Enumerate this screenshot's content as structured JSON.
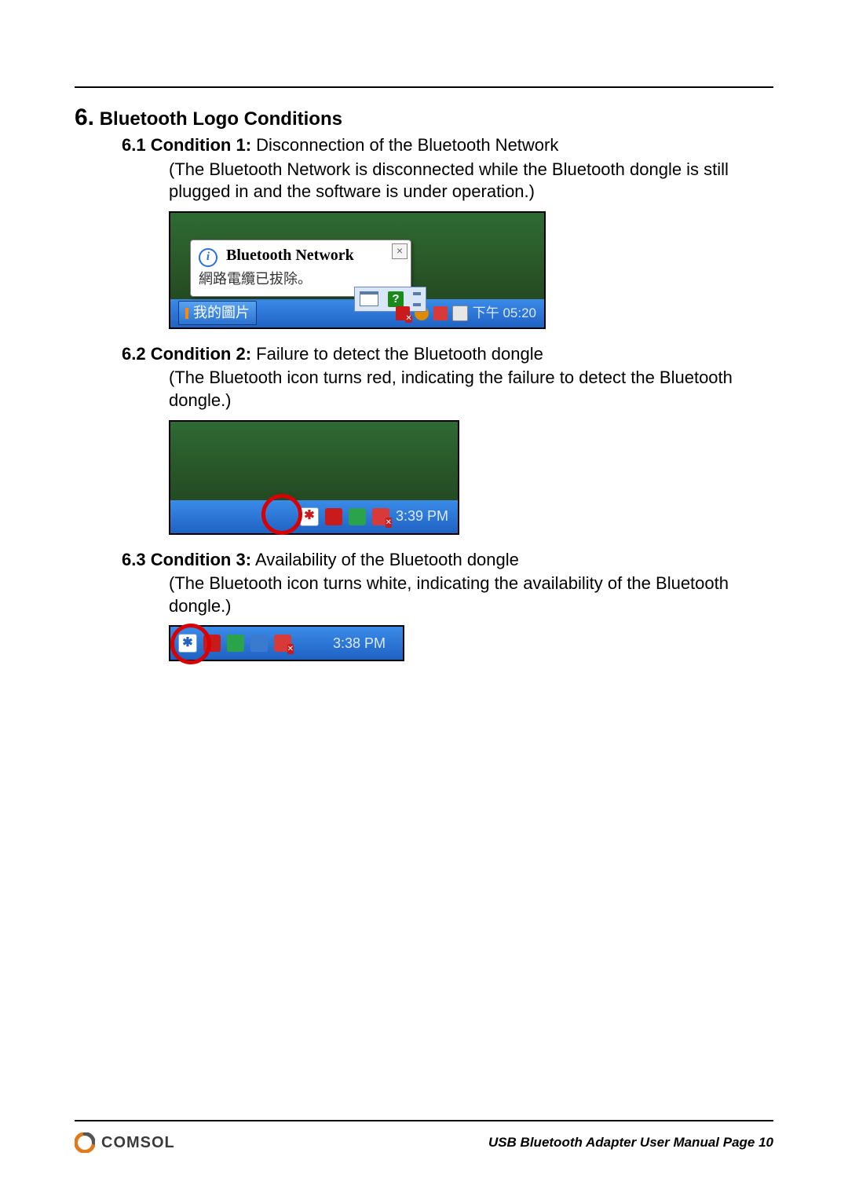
{
  "section": {
    "number": "6.",
    "title": "Bluetooth Logo Conditions"
  },
  "conditions": [
    {
      "num": "6.1",
      "label": "Condition 1:",
      "title": "Disconnection of the Bluetooth Network",
      "body": "(The Bluetooth Network is disconnected while the Bluetooth dongle is still plugged in and the software is under operation.)"
    },
    {
      "num": "6.2",
      "label": "Condition 2:",
      "title": "Failure to detect the Bluetooth dongle",
      "body": "(The Bluetooth icon turns red, indicating the failure to detect the Bluetooth dongle.)"
    },
    {
      "num": "6.3",
      "label": "Condition 3:",
      "title": "Availability of the Bluetooth dongle",
      "body": "(The Bluetooth icon turns white, indicating the availability of the Bluetooth dongle.)"
    }
  ],
  "fig1": {
    "balloon_title": "Bluetooth Network",
    "balloon_sub": "網路電纜已拔除。",
    "task_button": "我的圖片",
    "clock": "下午 05:20"
  },
  "fig2": {
    "clock": "3:39 PM"
  },
  "fig3": {
    "clock": "3:38 PM"
  },
  "footer": {
    "brand": "COMSOL",
    "text": "USB Bluetooth Adapter User Manual Page 10"
  },
  "glyphs": {
    "bt": "✱",
    "info": "i"
  }
}
